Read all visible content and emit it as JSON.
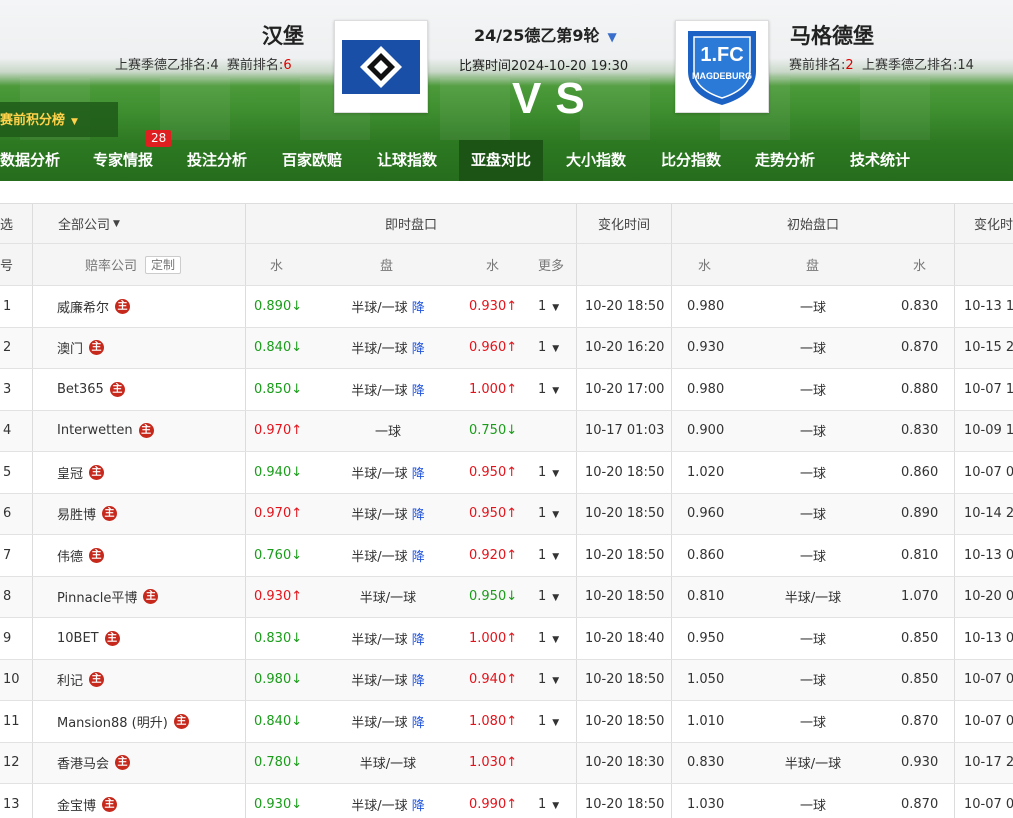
{
  "match": {
    "home_name": "汉堡",
    "home_last_season": "上赛季德乙排名:4",
    "home_pre_rank_label": "赛前排名:",
    "home_pre_rank": "6",
    "away_name": "马格德堡",
    "away_pre_rank_label": "赛前排名:",
    "away_pre_rank": "2",
    "away_last_season": "上赛季德乙排名:14",
    "round": "24/25德乙第9轮",
    "time": "比赛时间2024-10-20 19:30",
    "vs": "VS",
    "standings_button": "赛前积分榜"
  },
  "nav": {
    "items": [
      "数据分析",
      "专家情报",
      "投注分析",
      "百家欧赔",
      "让球指数",
      "亚盘对比",
      "大小指数",
      "比分指数",
      "走势分析",
      "技术统计"
    ],
    "active_index": 5,
    "badge_count": "28"
  },
  "table": {
    "headers": {
      "select": "选",
      "company_filter": "全部公司",
      "live": "即时盘口",
      "change_time": "变化时间",
      "initial": "初始盘口",
      "change_time2": "变化时"
    },
    "subheaders": {
      "no": "号",
      "company": "赔率公司",
      "custom": "定制",
      "water1": "水",
      "handicap": "盘",
      "water2": "水",
      "more": "更多",
      "init_water1": "水",
      "init_handicap": "盘",
      "init_water2": "水"
    },
    "home_tag": "主",
    "down_tag": "降",
    "rows": [
      {
        "no": "1",
        "company": "威廉希尔",
        "w1": "0.890",
        "w1_dir": "down",
        "pan": "半球/一球",
        "jiang": true,
        "w2": "0.930",
        "w2_dir": "up",
        "more": "1",
        "time": "10-20 18:50",
        "iw1": "0.980",
        "ipan": "一球",
        "iw2": "0.830",
        "t2": "10-13 1"
      },
      {
        "no": "2",
        "company": "澳门",
        "w1": "0.840",
        "w1_dir": "down",
        "pan": "半球/一球",
        "jiang": true,
        "w2": "0.960",
        "w2_dir": "up",
        "more": "1",
        "time": "10-20 16:20",
        "iw1": "0.930",
        "ipan": "一球",
        "iw2": "0.870",
        "t2": "10-15 2"
      },
      {
        "no": "3",
        "company": "Bet365",
        "w1": "0.850",
        "w1_dir": "down",
        "pan": "半球/一球",
        "jiang": true,
        "w2": "1.000",
        "w2_dir": "up",
        "more": "1",
        "time": "10-20 17:00",
        "iw1": "0.980",
        "ipan": "一球",
        "iw2": "0.880",
        "t2": "10-07 1"
      },
      {
        "no": "4",
        "company": "Interwetten",
        "w1": "0.970",
        "w1_dir": "up",
        "pan": "一球",
        "jiang": false,
        "w2": "0.750",
        "w2_dir": "down",
        "more": "",
        "time": "10-17 01:03",
        "iw1": "0.900",
        "ipan": "一球",
        "iw2": "0.830",
        "t2": "10-09 1"
      },
      {
        "no": "5",
        "company": "皇冠",
        "w1": "0.940",
        "w1_dir": "down",
        "pan": "半球/一球",
        "jiang": true,
        "w2": "0.950",
        "w2_dir": "up",
        "more": "1",
        "time": "10-20 18:50",
        "iw1": "1.020",
        "ipan": "一球",
        "iw2": "0.860",
        "t2": "10-07 0"
      },
      {
        "no": "6",
        "company": "易胜博",
        "w1": "0.970",
        "w1_dir": "up",
        "pan": "半球/一球",
        "jiang": true,
        "w2": "0.950",
        "w2_dir": "up",
        "more": "1",
        "time": "10-20 18:50",
        "iw1": "0.960",
        "ipan": "一球",
        "iw2": "0.890",
        "t2": "10-14 2"
      },
      {
        "no": "7",
        "company": "伟德",
        "w1": "0.760",
        "w1_dir": "down",
        "pan": "半球/一球",
        "jiang": true,
        "w2": "0.920",
        "w2_dir": "up",
        "more": "1",
        "time": "10-20 18:50",
        "iw1": "0.860",
        "ipan": "一球",
        "iw2": "0.810",
        "t2": "10-13 0"
      },
      {
        "no": "8",
        "company": "Pinnacle平博",
        "w1": "0.930",
        "w1_dir": "up",
        "pan": "半球/一球",
        "jiang": false,
        "w2": "0.950",
        "w2_dir": "down",
        "more": "1",
        "time": "10-20 18:50",
        "iw1": "0.810",
        "ipan": "半球/一球",
        "iw2": "1.070",
        "t2": "10-20 0"
      },
      {
        "no": "9",
        "company": "10BET",
        "w1": "0.830",
        "w1_dir": "down",
        "pan": "半球/一球",
        "jiang": true,
        "w2": "1.000",
        "w2_dir": "up",
        "more": "1",
        "time": "10-20 18:40",
        "iw1": "0.950",
        "ipan": "一球",
        "iw2": "0.850",
        "t2": "10-13 0"
      },
      {
        "no": "10",
        "company": "利记",
        "w1": "0.980",
        "w1_dir": "down",
        "pan": "半球/一球",
        "jiang": true,
        "w2": "0.940",
        "w2_dir": "up",
        "more": "1",
        "time": "10-20 18:50",
        "iw1": "1.050",
        "ipan": "一球",
        "iw2": "0.850",
        "t2": "10-07 0"
      },
      {
        "no": "11",
        "company": "Mansion88 (明升)",
        "w1": "0.840",
        "w1_dir": "down",
        "pan": "半球/一球",
        "jiang": true,
        "w2": "1.080",
        "w2_dir": "up",
        "more": "1",
        "time": "10-20 18:50",
        "iw1": "1.010",
        "ipan": "一球",
        "iw2": "0.870",
        "t2": "10-07 0"
      },
      {
        "no": "12",
        "company": "香港马会",
        "w1": "0.780",
        "w1_dir": "down",
        "pan": "半球/一球",
        "jiang": false,
        "w2": "1.030",
        "w2_dir": "up",
        "more": "",
        "time": "10-20 18:30",
        "iw1": "0.830",
        "ipan": "半球/一球",
        "iw2": "0.930",
        "t2": "10-17 2"
      },
      {
        "no": "13",
        "company": "金宝博",
        "w1": "0.930",
        "w1_dir": "down",
        "pan": "半球/一球",
        "jiang": true,
        "w2": "0.990",
        "w2_dir": "up",
        "more": "1",
        "time": "10-20 18:50",
        "iw1": "1.030",
        "ipan": "一球",
        "iw2": "0.870",
        "t2": "10-07 0"
      }
    ]
  },
  "colors": {
    "up": "#e3131b",
    "down": "#1a9c1a",
    "nav_bg": "#2d7a22",
    "home_tag": "#c6281c"
  }
}
